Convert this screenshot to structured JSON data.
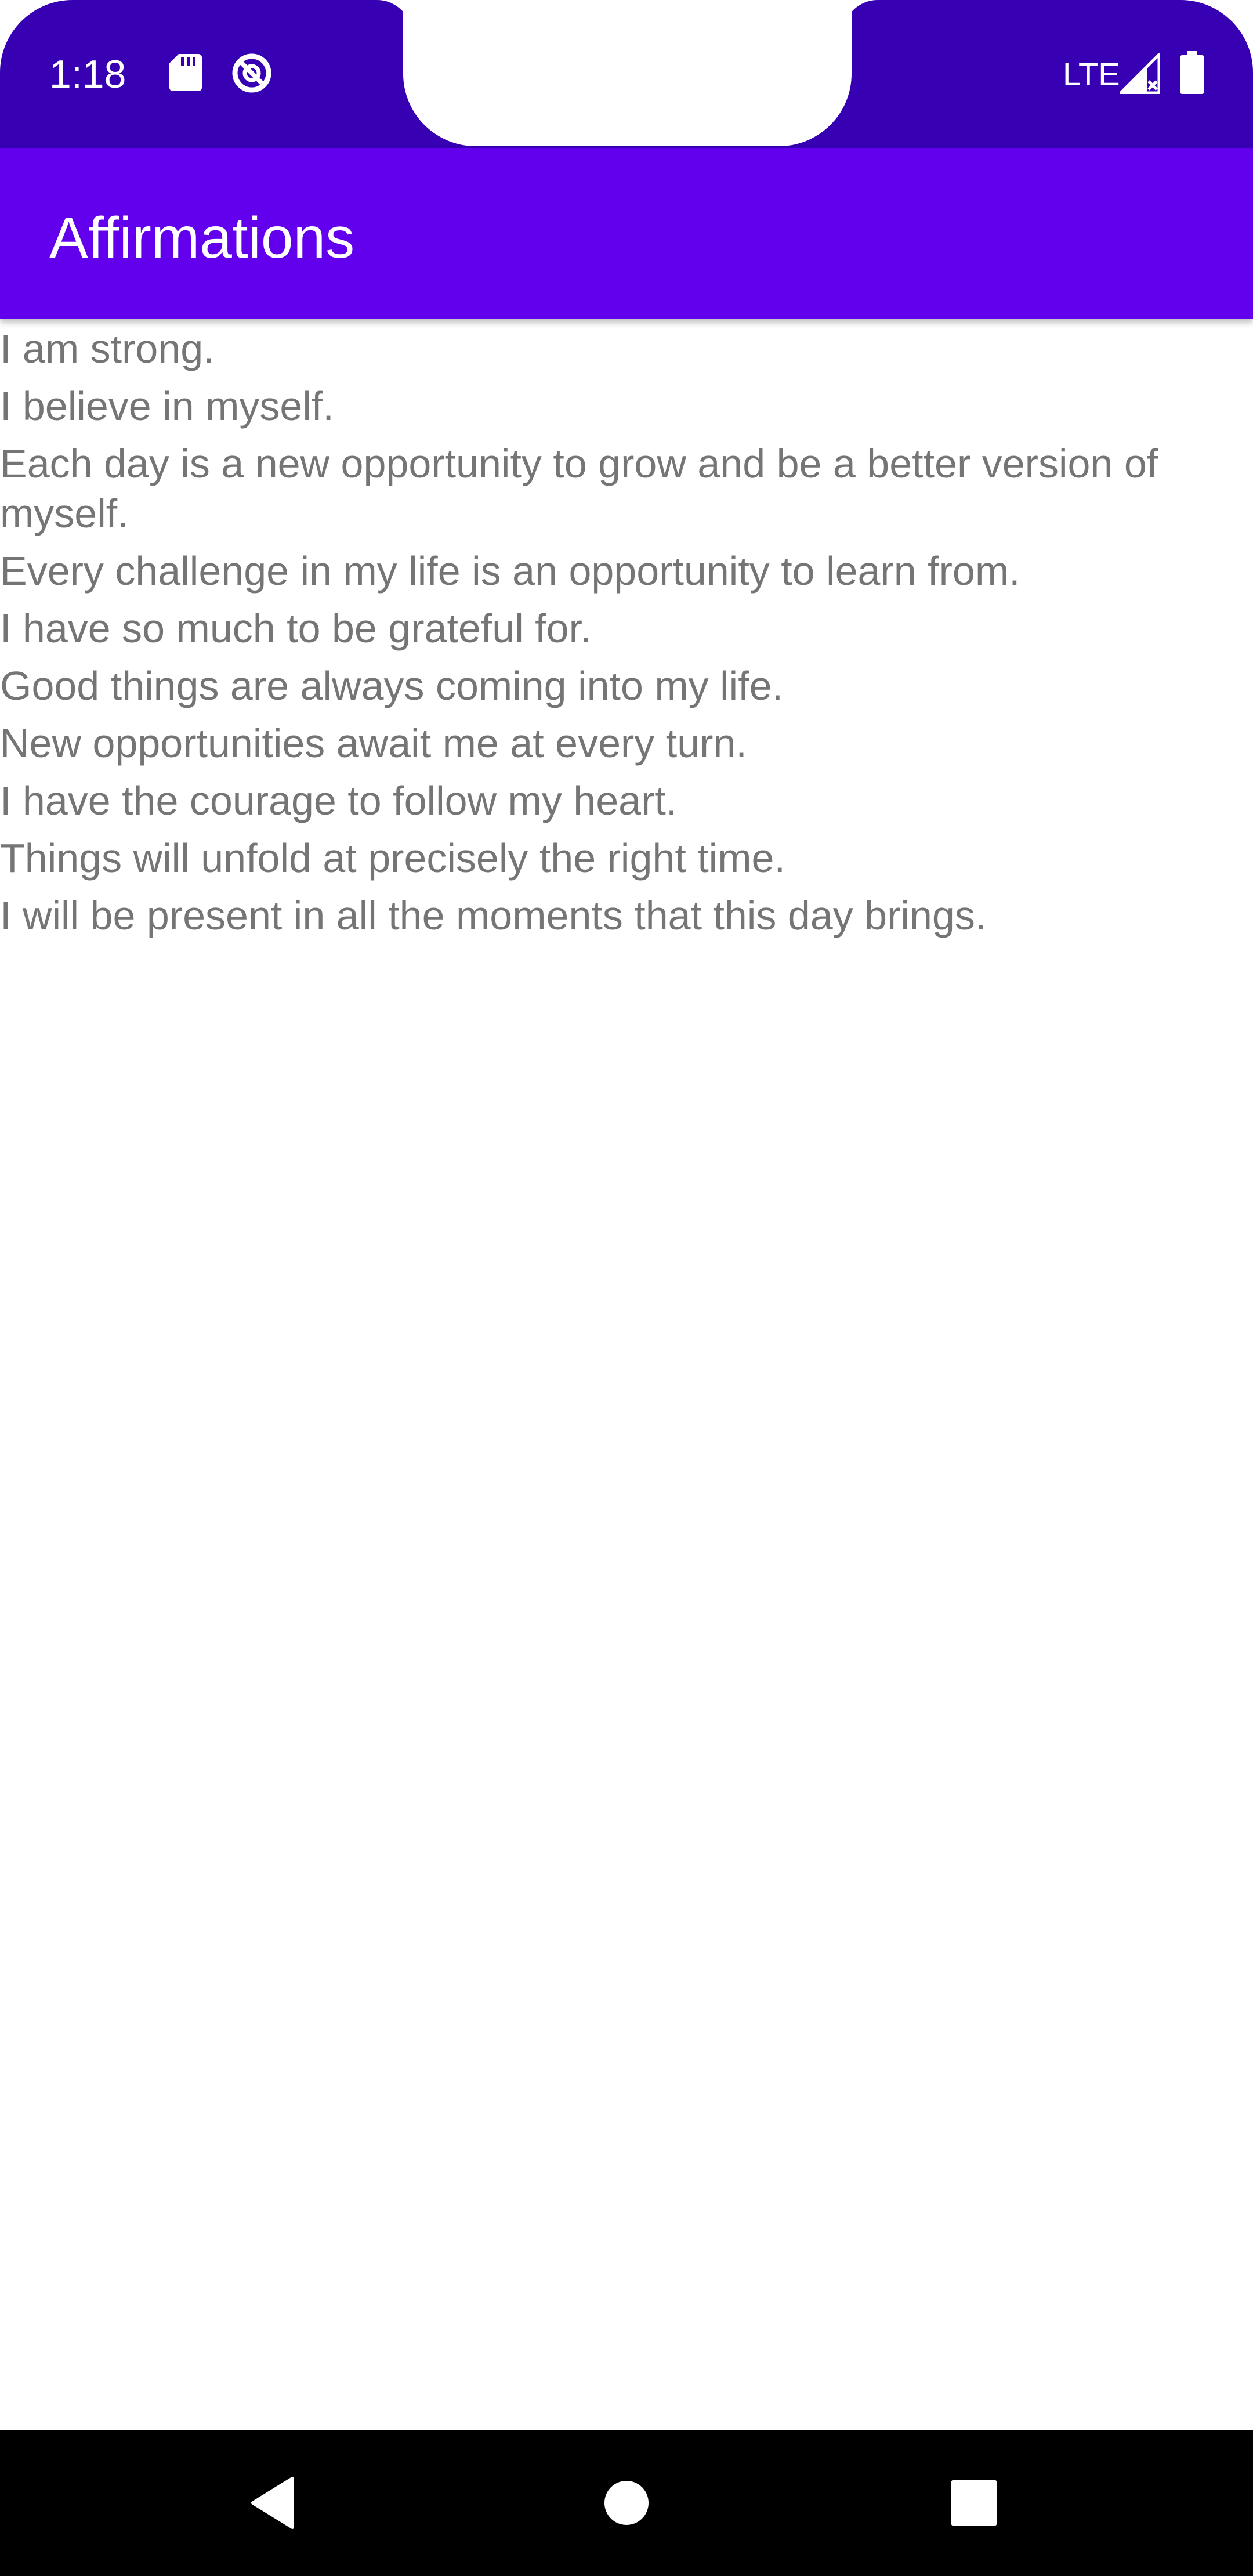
{
  "status_bar": {
    "time": "1:18",
    "network": "LTE",
    "icons": [
      "sd-card-icon",
      "data-saver-icon",
      "signal-icon",
      "battery-icon"
    ],
    "color": "#3700B3"
  },
  "app_bar": {
    "title": "Affirmations",
    "color": "#6200EE"
  },
  "affirmations": [
    "I am strong.",
    "I believe in myself.",
    "Each day is a new opportunity to grow and be a better version of myself.",
    "Every challenge in my life is an opportunity to learn from.",
    "I have so much to be grateful for.",
    "Good things are always coming into my life.",
    "New opportunities await me at every turn.",
    "I have the courage to follow my heart.",
    "Things will unfold at precisely the right time.",
    "I will be present in all the moments that this day brings."
  ],
  "nav_bar": {
    "buttons": [
      "back-icon",
      "home-icon",
      "recents-icon"
    ]
  }
}
